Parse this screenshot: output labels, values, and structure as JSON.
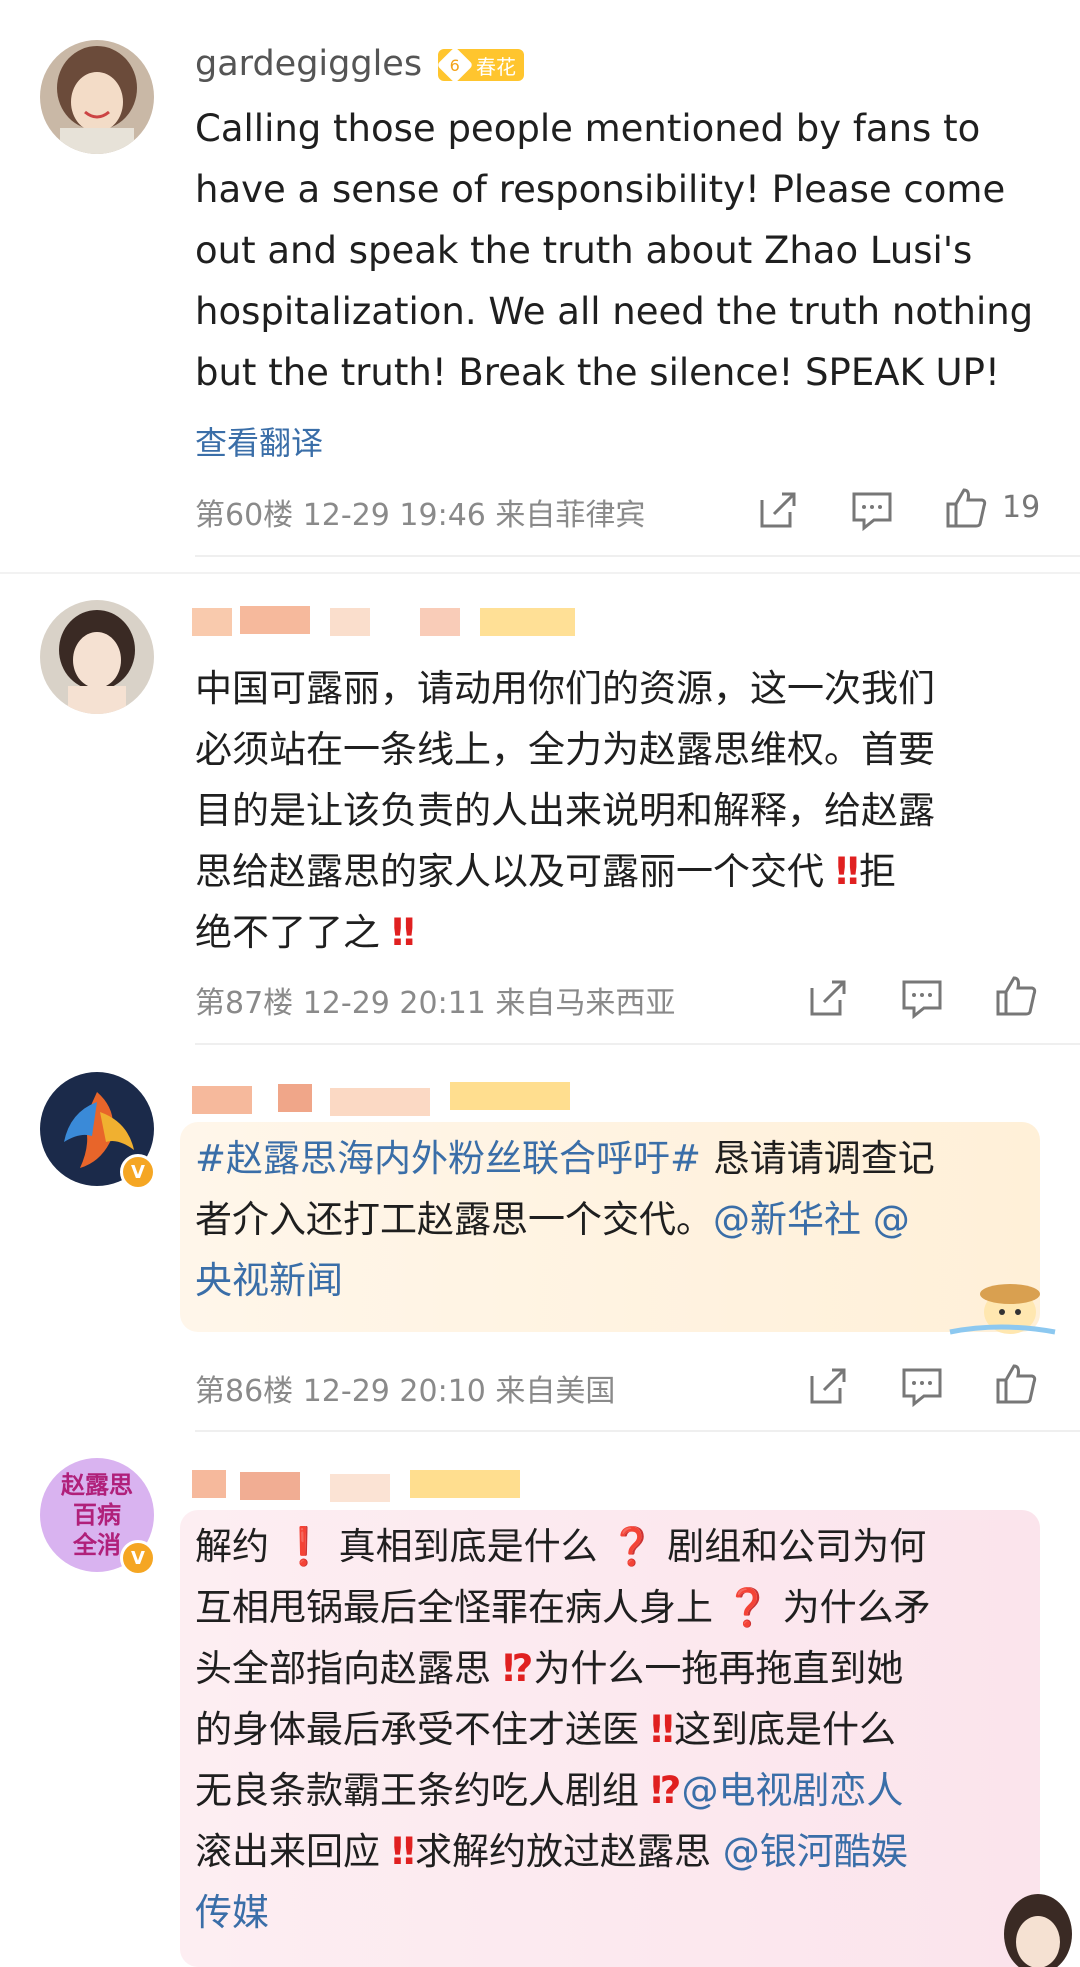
{
  "comments": [
    {
      "username": "gardegiggles",
      "level": "6",
      "badge": "春花",
      "text": "Calling those people mentioned by fans to have a sense of responsibility! Please come out and speak the truth about Zhao Lusi's hospitalization. We all need the truth nothing but the truth! Break the silence! SPEAK UP!",
      "translate_label": "查看翻译",
      "meta": "第60楼  12-29 19:46  来自菲律宾",
      "likes": "19"
    },
    {
      "username": "",
      "text_lines": [
        "中国可露丽，请动用你们的资源，这一次我们",
        "必须站在一条线上，全力为赵露思维权。首要",
        "目的是让该负责的人出来说明和解释，给赵露",
        "思给赵露思的家人以及可露丽一个交代",
        "拒",
        "绝不了了之"
      ],
      "meta": "第87楼  12-29 20:11  来自马来西亚"
    },
    {
      "username": "",
      "hashtag": "#赵露思海内外粉丝联合呼吁#",
      "text_a": " 恳请请调查记",
      "text_b": "者介入还打工赵露思一个交代。",
      "mention1": "@新华社",
      "mention2": "@",
      "text_c": "央视新闻",
      "meta": "第86楼  12-29 20:10  来自美国"
    },
    {
      "username": "",
      "avatar_text": "赵露思\n百病\n全消",
      "l1a": "解约",
      "l1b": "真相到底是什么",
      "l1c": "剧组和公司为何",
      "l2a": "互相甩锅最后全怪罪在病人身上",
      "l2b": "为什么矛",
      "l3a": "头全部指向赵露思",
      "l3b": "为什么一拖再拖直到她",
      "l4a": "的身体最后承受不住才送医",
      "l4b": "这到底是什么",
      "l5a": "无良条款霸王条约吃人剧组",
      "l5m": "@电视剧恋人",
      "l6a": "滚出来回应",
      "l6b": "求解约放过赵露思",
      "l6m": "@银河酷娱",
      "l7m": "传媒"
    }
  ],
  "colors": {
    "link": "#3a6ea8",
    "meta": "#8a8a8a",
    "badge": "#ffc52e",
    "accent": "#f5a623"
  }
}
